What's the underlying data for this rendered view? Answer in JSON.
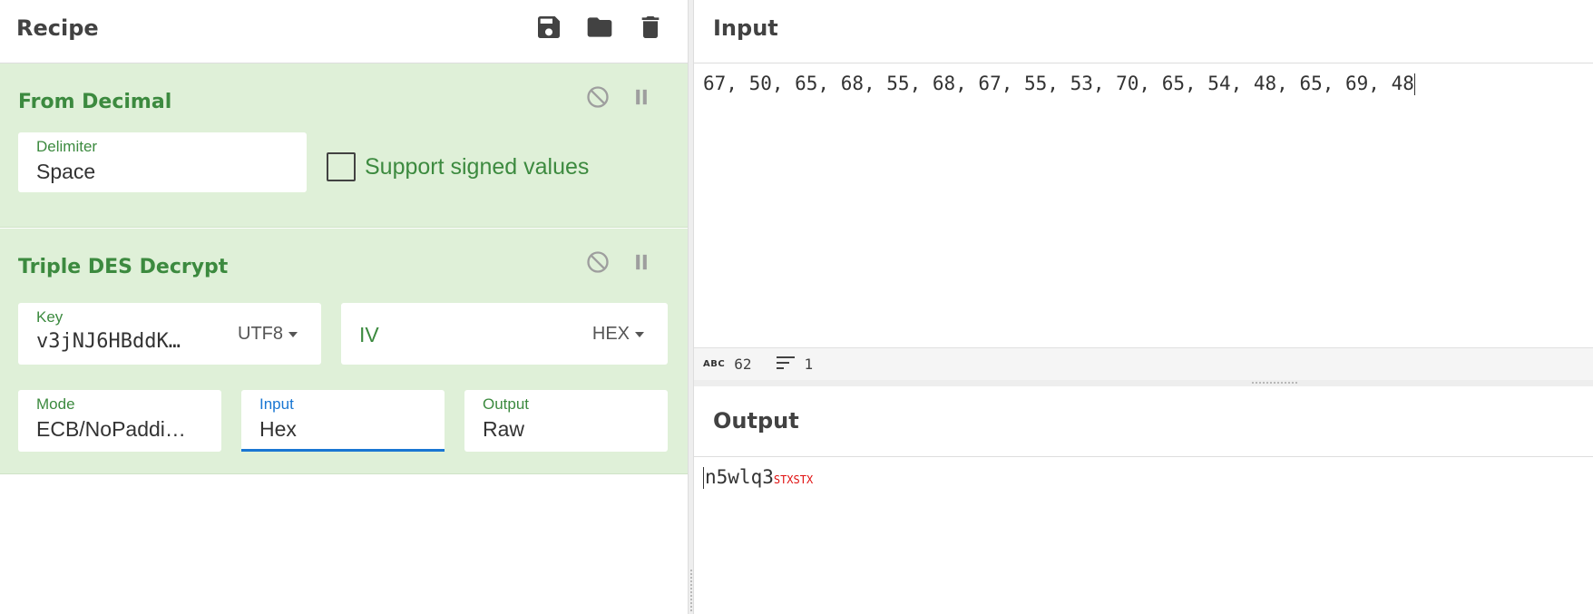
{
  "recipe": {
    "title": "Recipe",
    "operations": [
      {
        "title": "From Decimal",
        "delimiter": {
          "label": "Delimiter",
          "value": "Space"
        },
        "signed": {
          "label": "Support signed values",
          "checked": false
        }
      },
      {
        "title": "Triple DES Decrypt",
        "key": {
          "label": "Key",
          "value": "v3jNJ6HBddK…",
          "encoding": "UTF8"
        },
        "iv": {
          "label": "IV",
          "encoding": "HEX"
        },
        "mode": {
          "label": "Mode",
          "value": "ECB/NoPaddi…"
        },
        "input": {
          "label": "Input",
          "value": "Hex"
        },
        "output": {
          "label": "Output",
          "value": "Raw"
        }
      }
    ]
  },
  "io": {
    "input_title": "Input",
    "input_text": "67, 50, 65, 68, 55, 68, 67, 55, 53, 70, 65, 54, 48, 65, 69, 48",
    "status": {
      "chars": "62",
      "lines": "1"
    },
    "output_title": "Output",
    "output_text": "n5wlq3",
    "output_ctrl": "STXSTX"
  },
  "colors": {
    "op_bg": "#dff0d8",
    "op_green": "#3c8a3f",
    "active_blue": "#1976d2",
    "ctrl_red": "#e01010"
  }
}
